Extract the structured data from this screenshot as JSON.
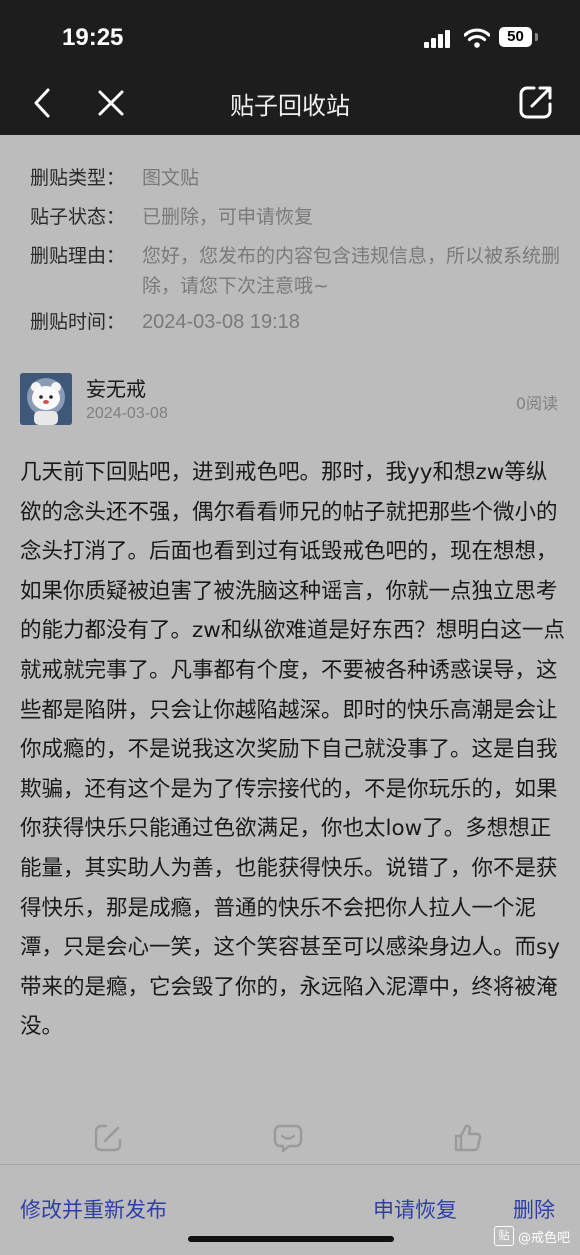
{
  "status_bar": {
    "time": "19:25",
    "battery": "50"
  },
  "nav": {
    "title": "贴子回收站"
  },
  "info": [
    {
      "label": "删贴类型：",
      "value": "图文贴"
    },
    {
      "label": "贴子状态：",
      "value": "已删除，可申请恢复"
    },
    {
      "label": "删贴理由：",
      "value": "您好，您发布的内容包含违规信息，所以被系统删除，请您下次注意哦~"
    },
    {
      "label": "删贴时间：",
      "value": "2024-03-08 19:18"
    }
  ],
  "author": {
    "name": "妄无戒",
    "date": "2024-03-08",
    "reads": "0阅读"
  },
  "post": {
    "body": "几天前下回贴吧，进到戒色吧。那时，我yy和想zw等纵欲的念头还不强，偶尔看看师兄的帖子就把那些个微小的念头打消了。后面也看到过有诋毁戒色吧的，现在想想，如果你质疑被迫害了被洗脑这种谣言，你就一点独立思考的能力都没有了。zw和纵欲难道是好东西？想明白这一点就戒就完事了。凡事都有个度，不要被各种诱惑误导，这些都是陷阱，只会让你越陷越深。即时的快乐高潮是会让你成瘾的，不是说我这次奖励下自己就没事了。这是自我欺骗，还有这个是为了传宗接代的，不是你玩乐的，如果你获得快乐只能通过色欲满足，你也太low了。多想想正能量，其实助人为善，也能获得快乐。说错了，你不是获得快乐，那是成瘾，普通的快乐不会把你人拉人一个泥潭，只是会心一笑，这个笑容甚至可以感染身边人。而sy带来的是瘾，它会毁了你的，永远陷入泥潭中，终将被淹没。"
  },
  "bottom": {
    "edit_repost": "修改并重新发布",
    "restore": "申请恢复",
    "delete": "删除"
  },
  "watermark": {
    "badge": "贴",
    "text": "@戒色吧"
  },
  "colors": {
    "accent": "#2f3fa8",
    "background": "#bcbcbc",
    "topbar": "#1d1d1d"
  }
}
